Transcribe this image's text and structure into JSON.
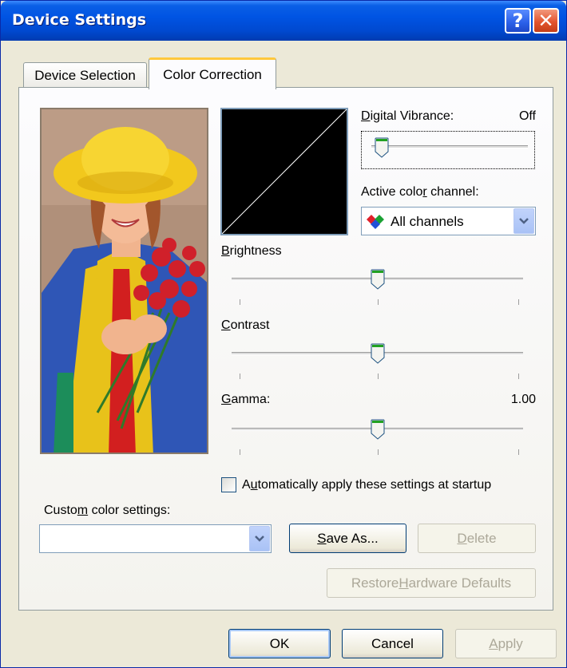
{
  "window": {
    "title": "Device Settings",
    "help_glyph": "?",
    "close_glyph": "✕",
    "titlebar_color": "#0054e3"
  },
  "tabs": [
    {
      "label": "Device Selection",
      "active": false
    },
    {
      "label": "Color Correction",
      "active": true
    }
  ],
  "preview": {
    "image": "woman-yellow-hat-red-flowers-photo"
  },
  "digital_vibrance": {
    "label_pre": "",
    "label_u": "D",
    "label_post": "igital Vibrance:",
    "value": "Off",
    "level": 0.0
  },
  "color_channel": {
    "label_pre": "Active colo",
    "label_u": "r",
    "label_post": " channel:",
    "selected": "All channels",
    "icon": "rgb-channels-icon"
  },
  "brightness": {
    "label_pre": "",
    "label_u": "B",
    "label_post": "rightness",
    "level": 0.5
  },
  "contrast": {
    "label_pre": "",
    "label_u": "C",
    "label_post": "ontrast",
    "level": 0.5
  },
  "gamma": {
    "label_pre": "",
    "label_u": "G",
    "label_post": "amma:",
    "value": "1.00",
    "level": 0.5
  },
  "auto_apply": {
    "label_pre": "A",
    "label_u": "u",
    "label_post": "tomatically apply these settings at startup",
    "checked": false
  },
  "custom": {
    "label_pre": "Custo",
    "label_u": "m",
    "label_post": " color settings:",
    "value": ""
  },
  "buttons": {
    "save_as": {
      "pre": "",
      "u": "S",
      "post": "ave As..."
    },
    "delete": {
      "pre": "",
      "u": "D",
      "post": "elete"
    },
    "restore": {
      "pre": "Restore ",
      "u": "H",
      "post": "ardware Defaults"
    },
    "ok": "OK",
    "cancel": "Cancel",
    "apply": {
      "pre": "",
      "u": "A",
      "post": "pply"
    }
  },
  "colors": {
    "accent": "#0054e3",
    "dialog_bg": "#ece9d8",
    "thumb": "#21a121"
  }
}
